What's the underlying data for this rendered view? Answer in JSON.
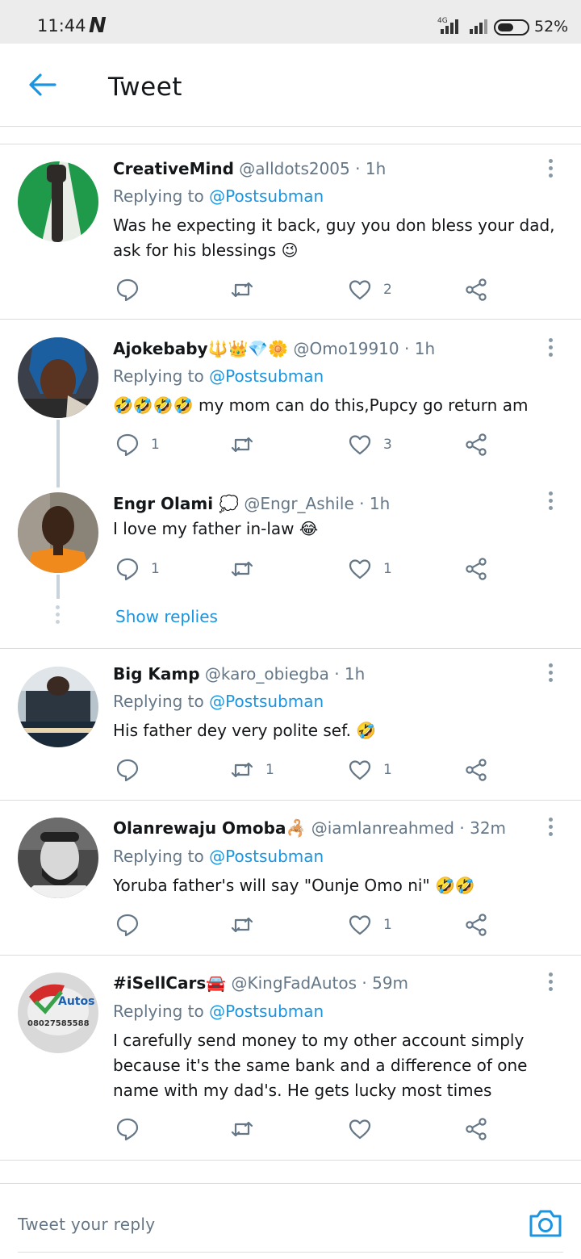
{
  "status_bar": {
    "time": "11:44",
    "network": "4G",
    "battery": "52%"
  },
  "header": {
    "title": "Tweet"
  },
  "tweets": [
    {
      "name": "CreativeMind",
      "handle": "@alldots2005",
      "time": "· 1h",
      "replying_prefix": "Replying to",
      "replying_to": "@Postsubman",
      "text": "Was he expecting it back, guy you don bless your dad, ask for his blessings 😉",
      "replies": "",
      "retweets": "",
      "likes": "2"
    },
    {
      "name": "Ajokebaby🔱👑💎🌼",
      "handle": "@Omo19910",
      "time": "· 1h",
      "replying_prefix": "Replying to",
      "replying_to": "@Postsubman",
      "text": "🤣🤣🤣🤣 my mom can do this,Pupcy go return am",
      "replies": "1",
      "retweets": "",
      "likes": "3"
    },
    {
      "name": "Engr Olami 💭",
      "handle": "@Engr_Ashile",
      "time": "· 1h",
      "text": "I love my father in-law 😂",
      "replies": "1",
      "retweets": "",
      "likes": "1"
    },
    {
      "name": "Big Kamp",
      "handle": "@karo_obiegba",
      "time": "· 1h",
      "replying_prefix": "Replying to",
      "replying_to": "@Postsubman",
      "text": "His father dey very polite sef. 🤣",
      "replies": "",
      "retweets": "1",
      "likes": "1"
    },
    {
      "name": "Olanrewaju Omoba🦂",
      "handle": "@iamlanreahmed",
      "time": "· 32m",
      "replying_prefix": "Replying to",
      "replying_to": "@Postsubman",
      "text": "Yoruba father's will say \"Ounje Omo ni\" 🤣🤣",
      "replies": "",
      "retweets": "",
      "likes": "1"
    },
    {
      "name": "#iSellCars🚘",
      "handle": "@KingFadAutos",
      "time": "· 59m",
      "replying_prefix": "Replying to",
      "replying_to": "@Postsubman",
      "text": "I carefully send money to my other account simply because it's the same bank and a difference of one name with my dad's. He gets lucky most times",
      "replies": "",
      "retweets": "",
      "likes": ""
    }
  ],
  "show_replies": "Show replies",
  "avatar_texts": {
    "autos": "Autos",
    "phone": "08027585588"
  },
  "compose": {
    "placeholder": "Tweet your reply"
  },
  "colors": {
    "accent": "#1b95e0",
    "muted": "#657786",
    "icon": "#657786"
  }
}
